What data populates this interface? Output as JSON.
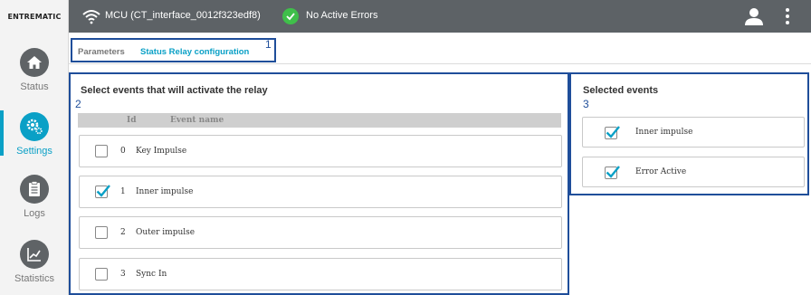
{
  "brand": {
    "logo_text": "ENTREMATIC"
  },
  "sidebar": {
    "items": [
      {
        "label": "Status",
        "icon": "home-icon",
        "active": false
      },
      {
        "label": "Settings",
        "icon": "gears-icon",
        "active": true
      },
      {
        "label": "Logs",
        "icon": "clipboard-icon",
        "active": false
      },
      {
        "label": "Statistics",
        "icon": "chart-icon",
        "active": false
      }
    ]
  },
  "header": {
    "connection_text": "MCU (CT_interface_0012f323edf8)",
    "status_text": "No Active Errors",
    "icons": [
      "wifi-icon",
      "check-circle-icon",
      "user-icon",
      "more-vertical-icon"
    ]
  },
  "breadcrumb": {
    "parent": "Parameters",
    "current": "Status Relay configuration"
  },
  "annotations": {
    "a1": "1",
    "a2": "2",
    "a3": "3"
  },
  "events_panel": {
    "title": "Select events that will activate the relay",
    "columns": {
      "id": "Id",
      "name": "Event name"
    },
    "rows": [
      {
        "id": "0",
        "name": "Key Impulse",
        "checked": false
      },
      {
        "id": "1",
        "name": "Inner impulse",
        "checked": true
      },
      {
        "id": "2",
        "name": "Outer impulse",
        "checked": false
      },
      {
        "id": "3",
        "name": "Sync In",
        "checked": false
      }
    ]
  },
  "selected_panel": {
    "title": "Selected events",
    "items": [
      {
        "name": "Inner impulse",
        "checked": true
      },
      {
        "name": "Error Active",
        "checked": true
      }
    ]
  },
  "colors": {
    "accent": "#0aa0c6",
    "header_bg": "#5d6266",
    "annotation_border": "#1f4e9a",
    "ok_green": "#3fbf4a"
  }
}
